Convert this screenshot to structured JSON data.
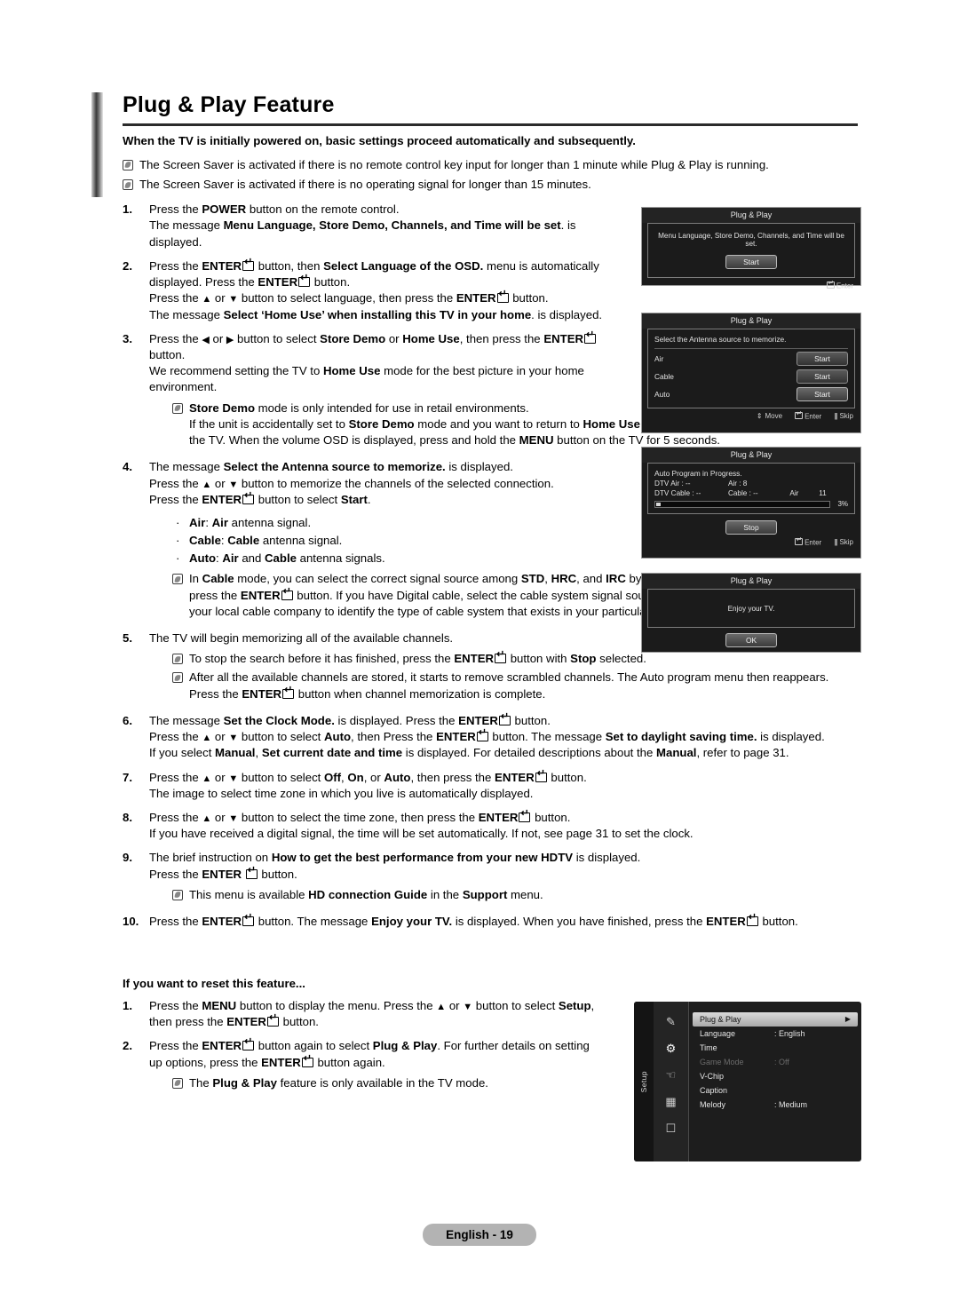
{
  "document": {
    "title": "Plug & Play Feature",
    "lead": "When the TV is initially powered on, basic settings proceed automatically and subsequently.",
    "top_notes": [
      "The Screen Saver is activated if there is no remote control key input for longer than 1 minute while Plug & Play is running.",
      "The Screen Saver is activated if there is no operating signal for longer than 15 minutes."
    ],
    "footer_page": "English - 19"
  },
  "steps": [
    {
      "num": "1.",
      "lines": [
        "Press the <b>POWER</b> button on the remote control.",
        "The message <b>Menu Language, Store Demo, Channels, and Time will be set</b>. is",
        "displayed."
      ]
    },
    {
      "num": "2.",
      "lines": [
        "Press the <b>ENTER</b><span class=\"ent\"></span> button, then <b>Select Language of the OSD.</b> menu is automatically",
        "displayed. Press the <b>ENTER</b><span class=\"ent\"></span> button.",
        "Press the <span class=\"arw\">▲</span> or <span class=\"arw\">▼</span> button to select language, then press the <b>ENTER</b><span class=\"ent\"></span> button.",
        "The message <b>Select ‘Home Use’ when installing this TV in your home</b>. is displayed."
      ]
    },
    {
      "num": "3.",
      "lines": [
        "Press the <span class=\"arw\">◀</span> or <span class=\"arw\">▶</span> button to select <b>Store Demo</b> or <b>Home Use</b>, then press the <b>ENTER</b><span class=\"ent\"></span>",
        "button.",
        "We recommend setting the TV to <b>Home Use</b> mode for the best picture in your home",
        "environment."
      ],
      "notes": [
        "<b>Store Demo</b> mode is only intended for use in retail environments.<br>If the unit is accidentally set to <b>Store Demo</b> mode and you want to return to <b>Home Use</b> (Standard): Press the Volume button on the TV. When the volume OSD is displayed, press and hold the <b>MENU</b> button on the TV for 5 seconds."
      ]
    },
    {
      "num": "4.",
      "lines": [
        "The message <b>Select the Antenna source to memorize.</b> is displayed.",
        "Press the <span class=\"arw\">▲</span> or <span class=\"arw\">▼</span> button to memorize the channels of the selected connection.",
        "Press the <b>ENTER</b><span class=\"ent\"></span> button to select <b>Start</b>."
      ],
      "bullets": [
        "<b>Air</b>: <b>Air</b> antenna signal.",
        "<b>Cable</b>: <b>Cable</b> antenna signal.",
        "<b>Auto</b>: <b>Air</b> and <b>Cable</b> antenna signals."
      ],
      "notes_after_bullets": [
        "In <b>Cable</b> mode, you can select the correct signal source among <b>STD</b>, <b>HRC</b>, and <b>IRC</b> by pressing the <span class=\"arw\">▲</span>, <span class=\"arw\">▼</span>, <span class=\"arw\">◀</span> or <span class=\"arw\">▶</span> button, then press the <b>ENTER</b><span class=\"ent\"></span> button. If you have Digital cable, select the cable system signal source for both Analog and Digital. Contact your local cable company to identify the type of cable system that exists in your particular area."
      ]
    },
    {
      "num": "5.",
      "lines": [
        "The TV will begin memorizing all of the available channels."
      ],
      "notes": [
        "To stop the search before it has finished, press the <b>ENTER</b><span class=\"ent\"></span> button with <b>Stop</b> selected.",
        "After all the available channels are stored, it starts to remove scrambled channels. The Auto program menu then reappears.<br>Press the <b>ENTER</b><span class=\"ent\"></span> button when channel memorization is complete."
      ]
    },
    {
      "num": "6.",
      "lines": [
        "The message <b>Set the Clock Mode.</b> is displayed. Press the <b>ENTER</b><span class=\"ent\"></span> button.",
        "Press the <span class=\"arw\">▲</span> or <span class=\"arw\">▼</span> button to select <b>Auto</b>, then Press the <b>ENTER</b><span class=\"ent\"></span> button. The message <b>Set to daylight saving time.</b> is displayed.",
        "If you select <b>Manual</b>, <b>Set current date and time</b> is displayed. For detailed descriptions about the <b>Manual</b>, refer to page 31."
      ]
    },
    {
      "num": "7.",
      "lines": [
        "Press the <span class=\"arw\">▲</span> or <span class=\"arw\">▼</span> button to select <b>Off</b>, <b>On</b>, or <b>Auto</b>, then press the <b>ENTER</b><span class=\"ent\"></span> button.",
        "The image to select time zone in which you live is automatically displayed."
      ]
    },
    {
      "num": "8.",
      "lines": [
        "Press the <span class=\"arw\">▲</span> or <span class=\"arw\">▼</span> button to select the time zone, then press the <b>ENTER</b><span class=\"ent\"></span> button.",
        "If you have received a digital signal, the time will be set automatically. If not, see page 31 to set the clock."
      ]
    },
    {
      "num": "9.",
      "lines": [
        "The brief instruction on <b>How to get the best performance from your new HDTV</b> is displayed.",
        "Press the <b>ENTER</b> <span class=\"ent\"></span> button."
      ],
      "notes": [
        "This menu is available <b>HD connection Guide</b> in the <b>Support</b> menu."
      ]
    },
    {
      "num": "10.",
      "lines": [
        "Press the <b>ENTER</b><span class=\"ent\"></span> button. The message <b>Enjoy your TV.</b> is displayed. When you have finished, press the <b>ENTER</b><span class=\"ent\"></span> button."
      ]
    }
  ],
  "reset_section": {
    "heading": "If you want to reset this feature...",
    "steps": [
      {
        "num": "1.",
        "lines": [
          "Press the <b>MENU</b> button to display the menu. Press the <span class=\"arw\">▲</span> or <span class=\"arw\">▼</span> button to select <b>Setup</b>,",
          "then press the <b>ENTER</b><span class=\"ent\"></span> button."
        ]
      },
      {
        "num": "2.",
        "lines": [
          "Press the <b>ENTER</b><span class=\"ent\"></span> button again to select <b>Plug &amp; Play</b>. For further details on setting",
          "up options, press the <b>ENTER</b><span class=\"ent\"></span> button again."
        ],
        "notes": [
          "The <b>Plug &amp; Play</b> feature is only available in the TV mode."
        ]
      }
    ]
  },
  "osd_panels": {
    "panel1": {
      "title": "Plug & Play",
      "message": "Menu Language, Store Demo, Channels, and Time will be set.",
      "button": "Start",
      "footer_enter": "Enter"
    },
    "panel2": {
      "title": "Plug & Play",
      "message": "Select the Antenna source to memorize.",
      "rows": [
        {
          "label": "Air",
          "button": "Start"
        },
        {
          "label": "Cable",
          "button": "Start"
        },
        {
          "label": "Auto",
          "button": "Start"
        }
      ],
      "footer_move": "Move",
      "footer_enter": "Enter",
      "footer_skip": "Skip"
    },
    "panel3": {
      "title": "Plug & Play",
      "message": "Auto Program in Progress.",
      "rows": [
        {
          "c1": "DTV Air : --",
          "c2": "Air : 8",
          "c3": "",
          "c4": ""
        },
        {
          "c1": "DTV Cable : --",
          "c2": "Cable : --",
          "c3": "Air",
          "c4": "11"
        }
      ],
      "progress_percent": "3%",
      "progress_value": 3,
      "button": "Stop",
      "footer_enter": "Enter",
      "footer_skip": "Skip"
    },
    "panel4": {
      "title": "Plug & Play",
      "message": "Enjoy your TV.",
      "button": "OK"
    }
  },
  "setup_menu": {
    "tab_label": "Setup",
    "icons": [
      "picture-icon",
      "setup-gear-icon",
      "sound-icon",
      "input-icon",
      "support-icon"
    ],
    "rows": [
      {
        "name": "Plug & Play",
        "value": "",
        "selected": true,
        "disabled": false
      },
      {
        "name": "Language",
        "value": ": English",
        "selected": false,
        "disabled": false
      },
      {
        "name": "Time",
        "value": "",
        "selected": false,
        "disabled": false
      },
      {
        "name": "Game Mode",
        "value": ": Off",
        "selected": false,
        "disabled": true
      },
      {
        "name": "V-Chip",
        "value": "",
        "selected": false,
        "disabled": false
      },
      {
        "name": "Caption",
        "value": "",
        "selected": false,
        "disabled": false
      },
      {
        "name": "Melody",
        "value": ": Medium",
        "selected": false,
        "disabled": false
      }
    ]
  }
}
